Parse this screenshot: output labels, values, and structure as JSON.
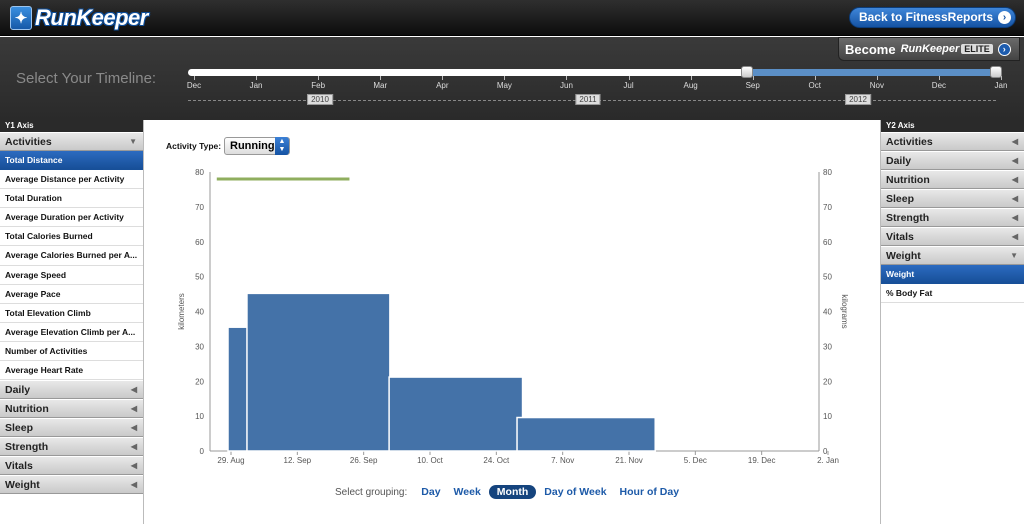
{
  "header": {
    "logo_text": "RunKeeper",
    "back_button": "Back to FitnessReports"
  },
  "elite": {
    "become": "Become",
    "brand": "RunKeeper",
    "badge": "ELITE"
  },
  "timeline": {
    "label": "Select Your Timeline:",
    "months": [
      "Dec",
      "Jan",
      "Feb",
      "Mar",
      "Apr",
      "May",
      "Jun",
      "Jul",
      "Aug",
      "Sep",
      "Oct",
      "Nov",
      "Dec",
      "Jan"
    ],
    "years": [
      "2010",
      "2011",
      "2012"
    ],
    "range_start_month": "Sep",
    "range_end_month": "Jan"
  },
  "left": {
    "axis_label": "Y1 Axis",
    "open_category": "Activities",
    "sub_items": [
      "Total Distance",
      "Average Distance per Activity",
      "Total Duration",
      "Average Duration per Activity",
      "Total Calories Burned",
      "Average Calories Burned per A...",
      "Average Speed",
      "Average Pace",
      "Total Elevation Climb",
      "Average Elevation Climb per A...",
      "Number of Activities",
      "Average Heart Rate"
    ],
    "selected_index": 0,
    "categories": [
      "Daily",
      "Nutrition",
      "Sleep",
      "Strength",
      "Vitals",
      "Weight"
    ]
  },
  "right": {
    "axis_label": "Y2 Axis",
    "categories": [
      "Activities",
      "Daily",
      "Nutrition",
      "Sleep",
      "Strength",
      "Vitals"
    ],
    "open_category": "Weight",
    "sub_items": [
      "Weight",
      "% Body Fat"
    ],
    "selected_index": 0
  },
  "main": {
    "activity_label": "Activity Type:",
    "activity_value": "Running",
    "grouping_label": "Select grouping:",
    "groupings": [
      "Day",
      "Week",
      "Month",
      "Day of Week",
      "Hour of Day"
    ],
    "active_grouping": "Month"
  },
  "colors": {
    "bar": "#4472a8",
    "weight_line": "#8fae5e",
    "accent": "#1d5aa8"
  },
  "chart_data": {
    "type": "bar",
    "x_ticks": [
      "29. Aug",
      "12. Sep",
      "26. Sep",
      "10. Oct",
      "24. Oct",
      "7. Nov",
      "21. Nov",
      "5. Dec",
      "19. Dec",
      "2. Jan"
    ],
    "series": [
      {
        "name": "kilometers",
        "axis": "left",
        "type": "bar",
        "bars": [
          {
            "start": "29. Aug",
            "end": "12. Sep",
            "value": 35.5
          },
          {
            "start": "2. Sep",
            "end": "29. Sep",
            "value": 45.2
          },
          {
            "start": "2. Oct",
            "end": "27. Oct",
            "value": 21.2
          },
          {
            "start": "29. Oct",
            "end": "24. Nov",
            "value": 9.6
          }
        ]
      },
      {
        "name": "kilograms",
        "axis": "right",
        "type": "line",
        "points": [
          {
            "x": "26. Aug",
            "value": 78
          },
          {
            "x": "23. Sep",
            "value": 78
          }
        ]
      }
    ],
    "ylabel": "kilometers",
    "y2label": "kilograms",
    "ylim": [
      0,
      80
    ],
    "y2lim": [
      0,
      80
    ],
    "yticks": [
      0,
      10,
      20,
      30,
      40,
      50,
      60,
      70,
      80
    ],
    "grid": false
  }
}
